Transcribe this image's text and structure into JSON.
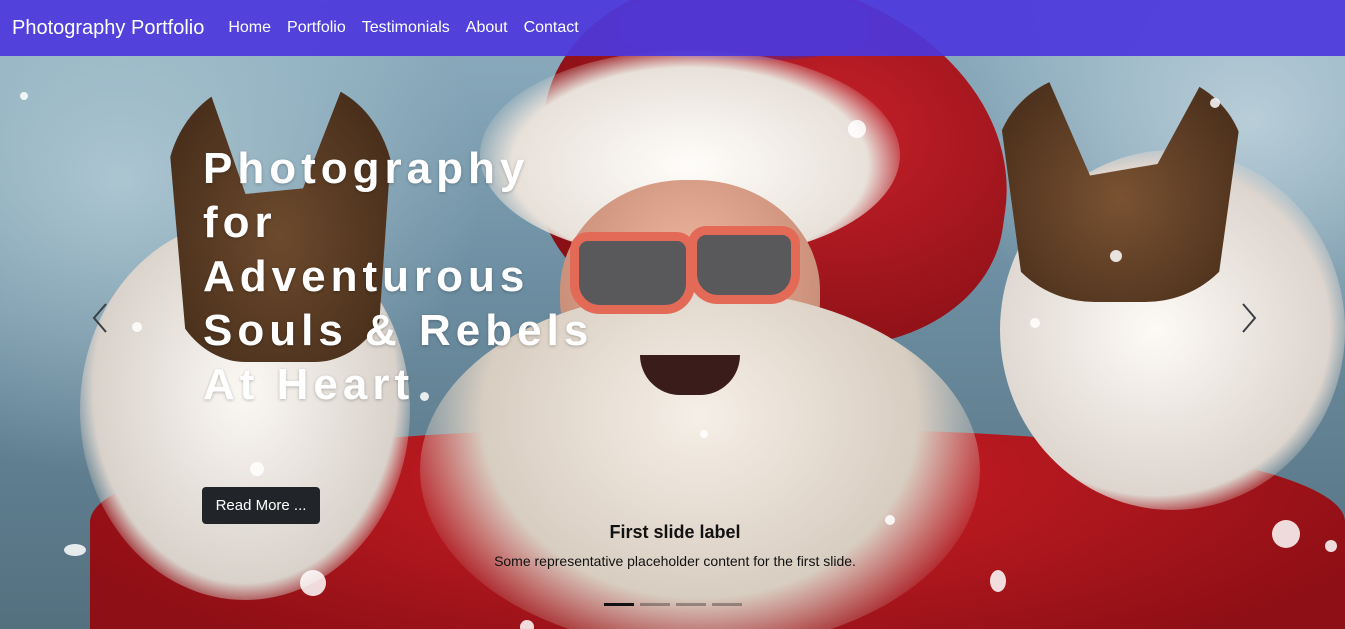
{
  "navbar": {
    "brand": "Photography Portfolio",
    "links": [
      "Home",
      "Portfolio",
      "Testimonials",
      "About",
      "Contact"
    ],
    "background_color": "#4c38dc"
  },
  "hero": {
    "headline_lines": [
      "Photography",
      "for",
      "Adventurous",
      "Souls & Rebels",
      "At Heart"
    ],
    "read_more_label": "Read More ...",
    "caption_title": "First slide label",
    "caption_text": "Some representative placeholder content for the first slide.",
    "prev_icon": "chevron-left-icon",
    "next_icon": "chevron-right-icon",
    "indicator_count": 4,
    "active_indicator": 1
  }
}
